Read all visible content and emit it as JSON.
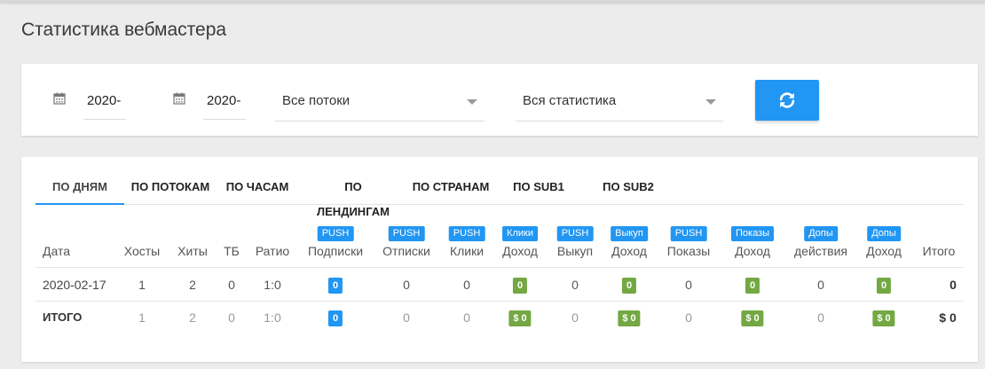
{
  "page": {
    "title": "Статистика вебмастера"
  },
  "filters": {
    "date_from": "2020-",
    "date_to": "2020-",
    "stream_select": "Все потоки",
    "stats_select": "Вся статистика"
  },
  "tabs": [
    {
      "label": "ПО ДНЯМ",
      "active": true
    },
    {
      "label": "ПО ПОТОКАМ"
    },
    {
      "label": "ПО ЧАСАМ"
    },
    {
      "label": "ПО ЛЕНДИНГАМ"
    },
    {
      "label": "ПО СТРАНАМ"
    },
    {
      "label": "ПО SUB1"
    },
    {
      "label": "ПО SUB2"
    }
  ],
  "table": {
    "headers": [
      {
        "badge": "",
        "label": "Дата"
      },
      {
        "badge": "",
        "label": "Хосты"
      },
      {
        "badge": "",
        "label": "Хиты"
      },
      {
        "badge": "",
        "label": "ТБ"
      },
      {
        "badge": "",
        "label": "Ратио"
      },
      {
        "badge": "PUSH",
        "label": "Подписки"
      },
      {
        "badge": "PUSH",
        "label": "Отписки"
      },
      {
        "badge": "PUSH",
        "label": "Клики"
      },
      {
        "badge": "Клики",
        "label": "Доход"
      },
      {
        "badge": "PUSH",
        "label": "Выкуп"
      },
      {
        "badge": "Выкуп",
        "label": "Доход"
      },
      {
        "badge": "PUSH",
        "label": "Показы"
      },
      {
        "badge": "Показы",
        "label": "Доход"
      },
      {
        "badge": "Допы",
        "label": "действия"
      },
      {
        "badge": "Допы",
        "label": "Доход"
      },
      {
        "badge": "",
        "label": "Итого"
      }
    ],
    "rows": [
      [
        "2020-02-17",
        "1",
        "2",
        "0",
        "1:0",
        "0",
        "0",
        "0",
        "0",
        "0",
        "0",
        "0",
        "0",
        "0",
        "0",
        "0"
      ],
      [
        "ИТОГО",
        "1",
        "2",
        "0",
        "1:0",
        "0",
        "0",
        "0",
        "$ 0",
        "0",
        "$ 0",
        "0",
        "$ 0",
        "0",
        "$ 0",
        "$ 0"
      ]
    ]
  },
  "colors": {
    "accent": "#2196f3",
    "money": "#73a843"
  },
  "icons": {
    "calendar": "calendar-icon",
    "refresh": "refresh-icon"
  }
}
